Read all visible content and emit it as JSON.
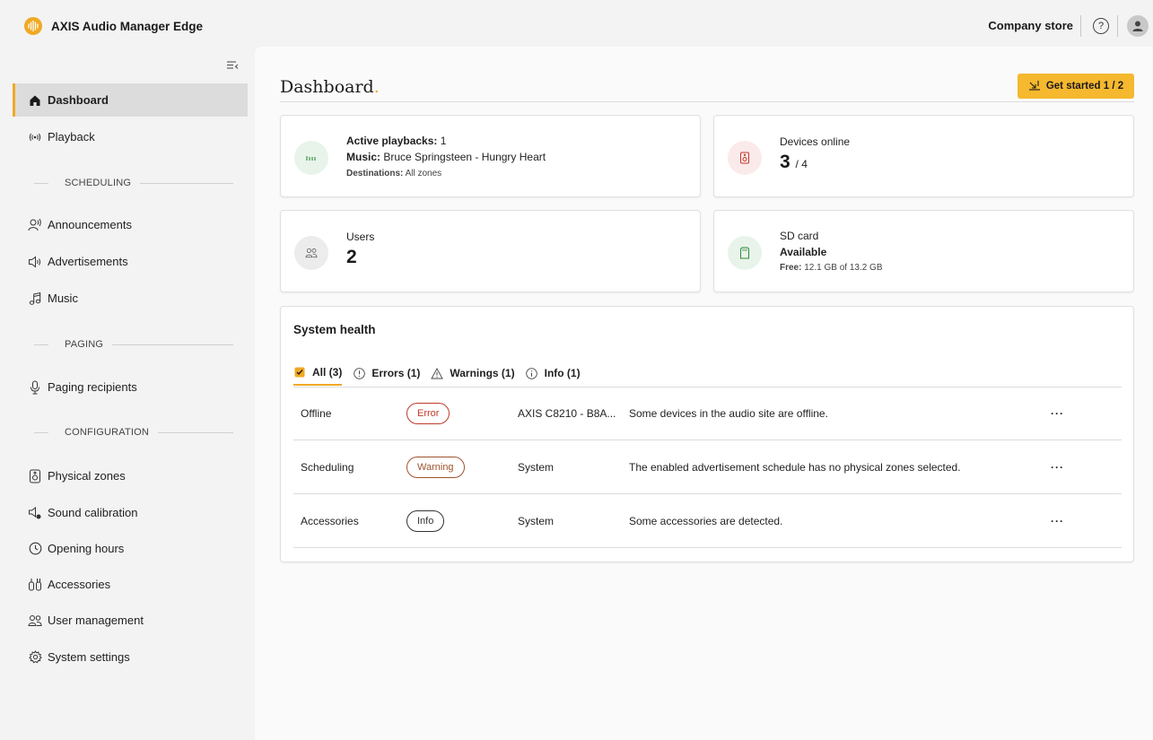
{
  "app": {
    "title": "AXIS Audio Manager Edge",
    "store_label": "Company store",
    "help_symbol": "?"
  },
  "sidebar": {
    "items": [
      {
        "label": "Dashboard",
        "icon": "home-icon"
      },
      {
        "label": "Playback",
        "icon": "broadcast-icon"
      },
      {
        "label": "Announcements",
        "icon": "speaking-person-icon"
      },
      {
        "label": "Advertisements",
        "icon": "speaker-icon"
      },
      {
        "label": "Music",
        "icon": "music-note-icon"
      },
      {
        "label": "Paging recipients",
        "icon": "microphone-icon"
      },
      {
        "label": "Physical zones",
        "icon": "zone-speaker-icon"
      },
      {
        "label": "Sound calibration",
        "icon": "calibration-icon"
      },
      {
        "label": "Opening hours",
        "icon": "clock-icon"
      },
      {
        "label": "Accessories",
        "icon": "accessories-icon"
      },
      {
        "label": "User management",
        "icon": "users-icon"
      },
      {
        "label": "System settings",
        "icon": "gear-icon"
      }
    ],
    "sections": {
      "scheduling": "SCHEDULING",
      "paging": "PAGING",
      "configuration": "CONFIGURATION"
    }
  },
  "main": {
    "title": "Dashboard",
    "title_dot": ".",
    "get_started": "Get started 1 / 2",
    "playbacks": {
      "label": "Active playbacks:",
      "count": "1",
      "music_label": "Music:",
      "music_value": "Bruce Springsteen - Hungry Heart",
      "dest_label": "Destinations:",
      "dest_value": "All zones"
    },
    "devices": {
      "label": "Devices online",
      "online": "3",
      "total": "/ 4"
    },
    "users": {
      "label": "Users",
      "count": "2"
    },
    "sdcard": {
      "label": "SD card",
      "status": "Available",
      "free_label": "Free:",
      "free_value": "12.1 GB of 13.2 GB"
    },
    "health": {
      "title": "System health",
      "tabs": [
        "All (3)",
        "Errors (1)",
        "Warnings (1)",
        "Info (1)"
      ],
      "rows": [
        {
          "category": "Offline",
          "severity": "Error",
          "source": "AXIS C8210 - B8A...",
          "message": "Some devices in the audio site are offline.",
          "more": "···"
        },
        {
          "category": "Scheduling",
          "severity": "Warning",
          "source": "System",
          "message": "The enabled advertisement schedule has no physical zones selected.",
          "more": "···"
        },
        {
          "category": "Accessories",
          "severity": "Info",
          "source": "System",
          "message": "Some accessories are detected.",
          "more": "···"
        }
      ]
    }
  },
  "colors": {
    "accent": "#f0a926",
    "error": "#c0392b",
    "warning": "#a0522d"
  }
}
